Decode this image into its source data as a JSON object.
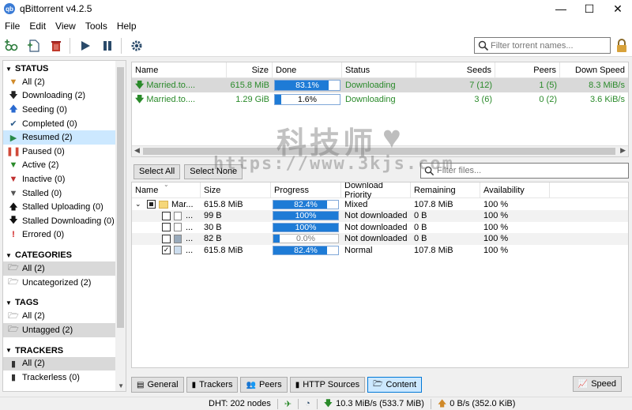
{
  "window": {
    "title": "qBittorrent v4.2.5",
    "minimize": "—",
    "maximize": "☐",
    "close": "✕",
    "app_icon": "qb"
  },
  "menu": [
    "File",
    "Edit",
    "View",
    "Tools",
    "Help"
  ],
  "toolbar": {
    "icons": [
      "add-link-icon",
      "add-file-icon",
      "delete-icon",
      "resume-icon",
      "pause-icon",
      "options-icon"
    ],
    "search_placeholder": "Filter torrent names...",
    "lock_icon": "lock-icon"
  },
  "sidebar": {
    "status_header": "STATUS",
    "status": [
      {
        "label": "All (2)",
        "icon": "filter-icon",
        "color": "#d08a2a"
      },
      {
        "label": "Downloading (2)",
        "icon": "arrow-down-icon",
        "color": "#222222"
      },
      {
        "label": "Seeding (0)",
        "icon": "arrow-up-icon",
        "color": "#2a6ad0"
      },
      {
        "label": "Completed (0)",
        "icon": "check-icon",
        "color": "#2a5a8a"
      },
      {
        "label": "Resumed (2)",
        "icon": "play-icon",
        "color": "#2a8a4a"
      },
      {
        "label": "Paused (0)",
        "icon": "pause-icon",
        "color": "#d04a3a"
      },
      {
        "label": "Active (2)",
        "icon": "filter-icon",
        "color": "#2a8a2a"
      },
      {
        "label": "Inactive (0)",
        "icon": "filter-icon",
        "color": "#c03030"
      },
      {
        "label": "Stalled (0)",
        "icon": "filter-icon",
        "color": "#555555"
      },
      {
        "label": "Stalled Uploading (0)",
        "icon": "arrow-up-icon",
        "color": "#111111"
      },
      {
        "label": "Stalled Downloading (0)",
        "icon": "arrow-down-icon",
        "color": "#111111"
      },
      {
        "label": "Errored (0)",
        "icon": "error-icon",
        "color": "#d02020"
      }
    ],
    "categories_header": "CATEGORIES",
    "categories": [
      "All (2)",
      "Uncategorized (2)"
    ],
    "tags_header": "TAGS",
    "tags": [
      "All (2)",
      "Untagged (2)"
    ],
    "trackers_header": "TRACKERS",
    "trackers": [
      "All (2)",
      "Trackerless (0)"
    ]
  },
  "torrents": {
    "columns": [
      "Name",
      "Size",
      "Done",
      "Status",
      "Seeds",
      "Peers",
      "Down Speed"
    ],
    "rows": [
      {
        "name": "Married.to....",
        "size": "615.8 MiB",
        "done": "83.1%",
        "progress": 0.831,
        "status": "Downloading",
        "seeds": "7 (12)",
        "peers": "1 (5)",
        "down": "8.3 MiB/s"
      },
      {
        "name": "Married.to....",
        "size": "1.29 GiB",
        "done": "1.6%",
        "progress": 0.016,
        "status": "Downloading",
        "seeds": "3 (6)",
        "peers": "0 (2)",
        "down": "3.6 KiB/s"
      }
    ]
  },
  "content": {
    "select_all": "Select All",
    "select_none": "Select None",
    "filter_placeholder": "Filter files...",
    "columns": [
      "Name",
      "Size",
      "Progress",
      "Download Priority",
      "Remaining",
      "Availability"
    ],
    "files": [
      {
        "name": "Mar...",
        "size": "615.8 MiB",
        "progress": 0.824,
        "progress_text": "82.4%",
        "priority": "Mixed",
        "remaining": "107.8 MiB",
        "availability": "100 %",
        "kind": "folder"
      },
      {
        "name": "...",
        "size": "99 B",
        "progress": 1.0,
        "progress_text": "100%",
        "priority": "Not downloaded",
        "remaining": "0 B",
        "availability": "100 %",
        "kind": "file"
      },
      {
        "name": "...",
        "size": "30 B",
        "progress": 1.0,
        "progress_text": "100%",
        "priority": "Not downloaded",
        "remaining": "0 B",
        "availability": "100 %",
        "kind": "file"
      },
      {
        "name": "...",
        "size": "82 B",
        "progress": 0.0,
        "progress_text": "0.0%",
        "priority": "Not downloaded",
        "remaining": "0 B",
        "availability": "100 %",
        "kind": "file"
      },
      {
        "name": "...",
        "size": "615.8 MiB",
        "progress": 0.824,
        "progress_text": "82.4%",
        "priority": "Normal",
        "remaining": "107.8 MiB",
        "availability": "100 %",
        "kind": "file"
      }
    ]
  },
  "tabs": [
    "General",
    "Trackers",
    "Peers",
    "HTTP Sources",
    "Content"
  ],
  "speed_button": "Speed",
  "statusbar": {
    "dht": "DHT: 202 nodes",
    "down": "10.3 MiB/s (533.7 MiB)",
    "up": "0 B/s (352.0 KiB)"
  },
  "watermark": {
    "cn": "科技师",
    "url": "https://www.3kjs.com"
  },
  "colors": {
    "accent": "#1e7bd6",
    "selection": "#cce8ff",
    "downloading": "#2a8a2a"
  }
}
